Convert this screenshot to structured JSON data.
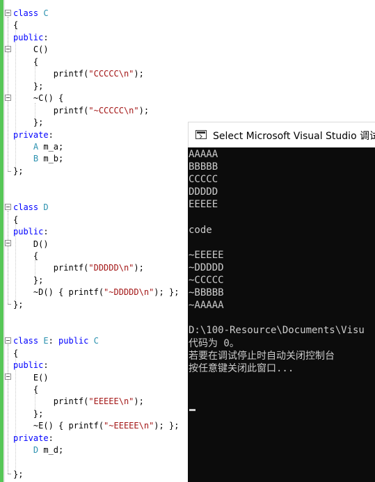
{
  "editor": {
    "lines": [
      {
        "k": "l1",
        "parts": [
          {
            "c": "kw",
            "t": "class"
          },
          {
            "c": "ty",
            "t": " C"
          }
        ]
      },
      {
        "k": "l2",
        "parts": [
          {
            "c": "punc",
            "t": "{"
          }
        ]
      },
      {
        "k": "l3",
        "parts": [
          {
            "c": "kw",
            "t": "public"
          },
          {
            "c": "punc",
            "t": ":"
          }
        ]
      },
      {
        "k": "l4",
        "parts": [
          {
            "c": "punc",
            "t": "    C()"
          }
        ]
      },
      {
        "k": "l5",
        "parts": [
          {
            "c": "punc",
            "t": "    {"
          }
        ]
      },
      {
        "k": "l6",
        "parts": [
          {
            "c": "punc",
            "t": "        printf("
          },
          {
            "c": "str",
            "t": "\"CCCCC\\n\""
          },
          {
            "c": "punc",
            "t": ");"
          }
        ]
      },
      {
        "k": "l7",
        "parts": [
          {
            "c": "punc",
            "t": "    };"
          }
        ]
      },
      {
        "k": "l8",
        "parts": [
          {
            "c": "punc",
            "t": "    ~C() {"
          }
        ]
      },
      {
        "k": "l9",
        "parts": [
          {
            "c": "punc",
            "t": "        printf("
          },
          {
            "c": "str",
            "t": "\"~CCCCC\\n\""
          },
          {
            "c": "punc",
            "t": ");"
          }
        ]
      },
      {
        "k": "l10",
        "parts": [
          {
            "c": "punc",
            "t": "    };"
          }
        ]
      },
      {
        "k": "l11",
        "parts": [
          {
            "c": "kw",
            "t": "private"
          },
          {
            "c": "punc",
            "t": ":"
          }
        ]
      },
      {
        "k": "l12",
        "parts": [
          {
            "c": "ty",
            "t": "    A"
          },
          {
            "c": "punc",
            "t": " m_a;"
          }
        ]
      },
      {
        "k": "l13",
        "parts": [
          {
            "c": "ty",
            "t": "    B"
          },
          {
            "c": "punc",
            "t": " m_b;"
          }
        ]
      },
      {
        "k": "l14",
        "parts": [
          {
            "c": "punc",
            "t": "};"
          }
        ]
      },
      {
        "k": "l15",
        "parts": []
      },
      {
        "k": "l16",
        "parts": []
      },
      {
        "k": "l17",
        "parts": [
          {
            "c": "kw",
            "t": "class"
          },
          {
            "c": "ty",
            "t": " D"
          }
        ]
      },
      {
        "k": "l18",
        "parts": [
          {
            "c": "punc",
            "t": "{"
          }
        ]
      },
      {
        "k": "l19",
        "parts": [
          {
            "c": "kw",
            "t": "public"
          },
          {
            "c": "punc",
            "t": ":"
          }
        ]
      },
      {
        "k": "l20",
        "parts": [
          {
            "c": "punc",
            "t": "    D()"
          }
        ]
      },
      {
        "k": "l21",
        "parts": [
          {
            "c": "punc",
            "t": "    {"
          }
        ]
      },
      {
        "k": "l22",
        "parts": [
          {
            "c": "punc",
            "t": "        printf("
          },
          {
            "c": "str",
            "t": "\"DDDDD\\n\""
          },
          {
            "c": "punc",
            "t": ");"
          }
        ]
      },
      {
        "k": "l23",
        "parts": [
          {
            "c": "punc",
            "t": "    };"
          }
        ]
      },
      {
        "k": "l24",
        "parts": [
          {
            "c": "punc",
            "t": "    ~D() { printf("
          },
          {
            "c": "str",
            "t": "\"~DDDDD\\n\""
          },
          {
            "c": "punc",
            "t": "); };"
          }
        ]
      },
      {
        "k": "l25",
        "parts": [
          {
            "c": "punc",
            "t": "};"
          }
        ]
      },
      {
        "k": "l26",
        "parts": []
      },
      {
        "k": "l27",
        "parts": []
      },
      {
        "k": "l28",
        "parts": [
          {
            "c": "kw",
            "t": "class"
          },
          {
            "c": "ty",
            "t": " E"
          },
          {
            "c": "punc",
            "t": ": "
          },
          {
            "c": "kw",
            "t": "public"
          },
          {
            "c": "ty",
            "t": " C"
          }
        ]
      },
      {
        "k": "l29",
        "parts": [
          {
            "c": "punc",
            "t": "{"
          }
        ]
      },
      {
        "k": "l30",
        "parts": [
          {
            "c": "kw",
            "t": "public"
          },
          {
            "c": "punc",
            "t": ":"
          }
        ]
      },
      {
        "k": "l31",
        "parts": [
          {
            "c": "punc",
            "t": "    E()"
          }
        ]
      },
      {
        "k": "l32",
        "parts": [
          {
            "c": "punc",
            "t": "    {"
          }
        ]
      },
      {
        "k": "l33",
        "parts": [
          {
            "c": "punc",
            "t": "        printf("
          },
          {
            "c": "str",
            "t": "\"EEEEE\\n\""
          },
          {
            "c": "punc",
            "t": ");"
          }
        ]
      },
      {
        "k": "l34",
        "parts": [
          {
            "c": "punc",
            "t": "    };"
          }
        ]
      },
      {
        "k": "l35",
        "parts": [
          {
            "c": "punc",
            "t": "    ~E() { printf("
          },
          {
            "c": "str",
            "t": "\"~EEEEE\\n\""
          },
          {
            "c": "punc",
            "t": "); };"
          }
        ]
      },
      {
        "k": "l36",
        "parts": [
          {
            "c": "kw",
            "t": "private"
          },
          {
            "c": "punc",
            "t": ":"
          }
        ]
      },
      {
        "k": "l37",
        "parts": [
          {
            "c": "ty",
            "t": "    D"
          },
          {
            "c": "punc",
            "t": " m_d;"
          }
        ]
      },
      {
        "k": "l38",
        "parts": []
      },
      {
        "k": "l39",
        "parts": [
          {
            "c": "punc",
            "t": "};"
          }
        ]
      }
    ]
  },
  "console": {
    "title": "Select Microsoft Visual Studio 调试",
    "output": [
      "AAAAA",
      "BBBBB",
      "CCCCC",
      "DDDDD",
      "EEEEE",
      "",
      "code",
      "",
      "~EEEEE",
      "~DDDDD",
      "~CCCCC",
      "~BBBBB",
      "~AAAAA",
      "",
      "D:\\100-Resource\\Documents\\Visu",
      "代码为 0。",
      "若要在调试停止时自动关闭控制台",
      "按任意键关闭此窗口..."
    ]
  },
  "colors": {
    "keyword": "#0000ff",
    "type": "#2b91af",
    "string": "#a31515",
    "console_bg": "#0c0c0c",
    "console_fg": "#cccccc",
    "gutter_green": "#57c757"
  }
}
